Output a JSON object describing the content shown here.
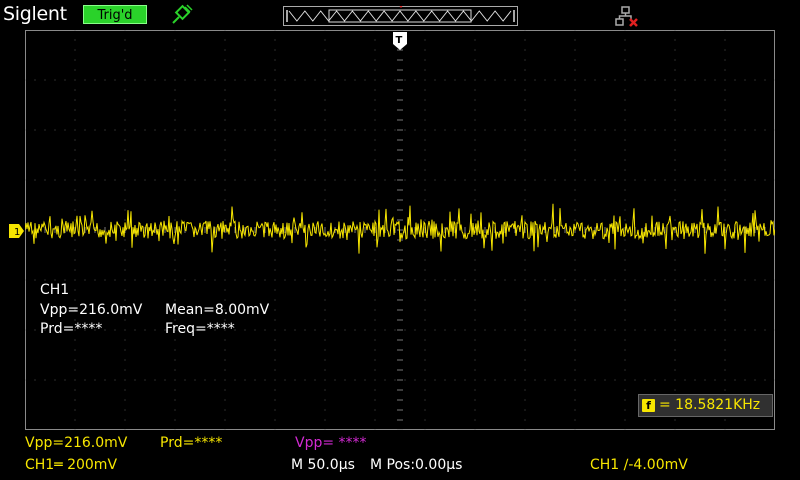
{
  "header": {
    "brand": "Siglent",
    "trigger_status": "Trig'd"
  },
  "channel_marker": "1",
  "trigger_marker": "T",
  "measurements": {
    "channel": "CH1",
    "vpp": "Vpp=216.0mV",
    "mean": "Mean=8.00mV",
    "prd": "Prd=****",
    "freq": "Freq=****"
  },
  "freq_counter": {
    "icon": "f",
    "value": "= 18.5821KHz"
  },
  "status": {
    "vpp_ch1": "Vpp=216.0mV",
    "prd_ch1": "Prd=****",
    "vpp_math": "Vpp= ****",
    "ch1_scale": "CH1═ 200mV",
    "timebase": "M 50.0µs",
    "mpos": "M Pos:0.00µs",
    "trigger": "CH1 ∕-4.00mV"
  },
  "colors": {
    "ch1": "#f7e600",
    "math": "#d22ad2",
    "trig_badge": "#2ad22a",
    "grid": "#4a4a4a"
  },
  "icons": [
    "usb-icon",
    "network-disconnected-icon",
    "trigger-position-icon",
    "channel-1-marker-icon"
  ]
}
